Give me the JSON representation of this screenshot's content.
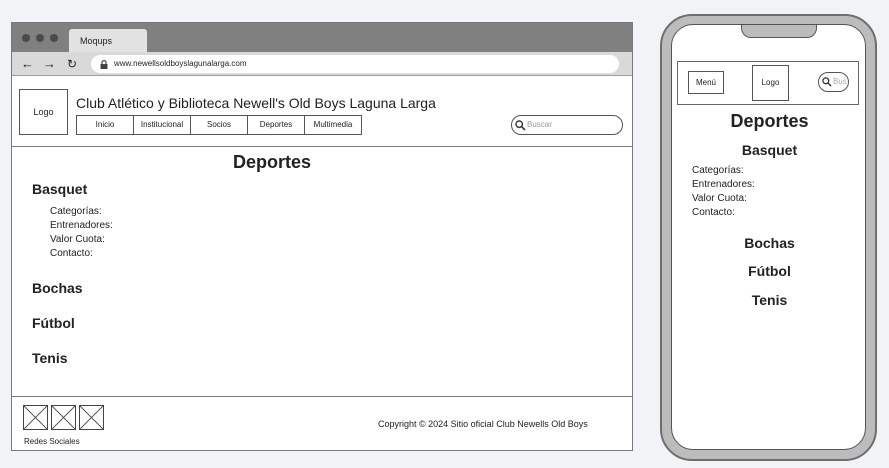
{
  "browser": {
    "tab_title": "Moqups",
    "url": "www.newellsoldboyslagunalarga.com",
    "back_icon": "←",
    "forward_icon": "→",
    "reload_icon": "↻"
  },
  "site": {
    "logo_label": "Logo",
    "title": "Club Atlético y Biblioteca Newell's Old Boys Laguna Larga",
    "menu": [
      "Inicio",
      "Institucional",
      "Socios",
      "Deportes",
      "Multimedia"
    ],
    "search_placeholder": "Buscar"
  },
  "page": {
    "title": "Deportes",
    "sports": [
      "Basquet",
      "Bochas",
      "Fútbol",
      "Tenis"
    ],
    "basquet_fields": [
      "Categorías:",
      "Entrenadores:",
      "Valor Cuota:",
      "Contacto:"
    ]
  },
  "footer": {
    "social_label": "Redes Sociales",
    "copyright": "Copyright © 2024 Sitio oficial Club Newells Old Boys"
  },
  "mobile": {
    "menu_label": "Menú",
    "logo_label": "Logo",
    "search_placeholder": "Bus",
    "title": "Deportes",
    "sports": [
      "Basquet",
      "Bochas",
      "Fútbol",
      "Tenis"
    ],
    "basquet_fields": [
      "Categorías:",
      "Entrenadores:",
      "Valor Cuota:",
      "Contacto:"
    ]
  },
  "colors": {
    "window_frame": "#808080",
    "address_bar": "#d9d9d9",
    "phone_body": "#bcbcbc",
    "page_background": "#f1f3f6"
  },
  "icons": [
    "lock-icon",
    "search-icon",
    "image-placeholder-icon"
  ]
}
